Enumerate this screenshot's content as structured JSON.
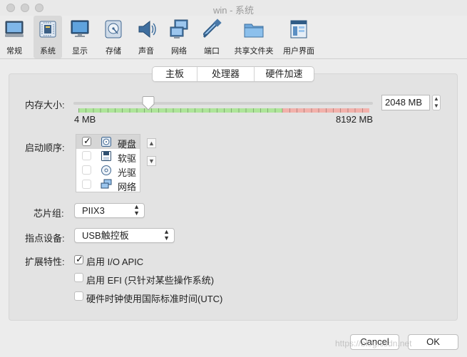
{
  "window": {
    "title": "win - 系统"
  },
  "toolbar": {
    "items": [
      {
        "label": "常规",
        "icon": "monitor-icon"
      },
      {
        "label": "系统",
        "icon": "chip-icon",
        "active": true
      },
      {
        "label": "显示",
        "icon": "display-icon"
      },
      {
        "label": "存储",
        "icon": "storage-icon"
      },
      {
        "label": "声音",
        "icon": "speaker-icon"
      },
      {
        "label": "网络",
        "icon": "network-icon"
      },
      {
        "label": "端口",
        "icon": "port-icon"
      },
      {
        "label": "共享文件夹",
        "icon": "folder-icon"
      },
      {
        "label": "用户界面",
        "icon": "ui-icon"
      }
    ]
  },
  "tabs": [
    {
      "label": "主板",
      "selected": true
    },
    {
      "label": "处理器"
    },
    {
      "label": "硬件加速"
    }
  ],
  "memory": {
    "label": "内存大小:",
    "value": "2048 MB",
    "min_label": "4 MB",
    "max_label": "8192 MB",
    "slider_fraction": 0.25,
    "good_color": "#aee59a",
    "bad_color": "#f2b1ab"
  },
  "boot": {
    "label": "启动顺序:",
    "items": [
      {
        "label": "硬盘",
        "checked": true,
        "icon": "disk-icon"
      },
      {
        "label": "软驱",
        "checked": false,
        "icon": "floppy-icon"
      },
      {
        "label": "光驱",
        "checked": false,
        "icon": "optical-icon"
      },
      {
        "label": "网络",
        "checked": false,
        "icon": "network-icon"
      }
    ]
  },
  "chipset": {
    "label": "芯片组:",
    "value": "PIIX3"
  },
  "pointing": {
    "label": "指点设备:",
    "value": "USB触控板"
  },
  "features": {
    "label": "扩展特性:",
    "items": [
      {
        "label": "启用 I/O APIC",
        "checked": true
      },
      {
        "label": "启用 EFI (只针对某些操作系统)",
        "checked": false
      },
      {
        "label": "硬件时钟使用国际标准时间(UTC)",
        "checked": false
      }
    ]
  },
  "buttons": {
    "cancel": "Cancel",
    "ok": "OK"
  },
  "watermark": "https://blog.csdn.net"
}
